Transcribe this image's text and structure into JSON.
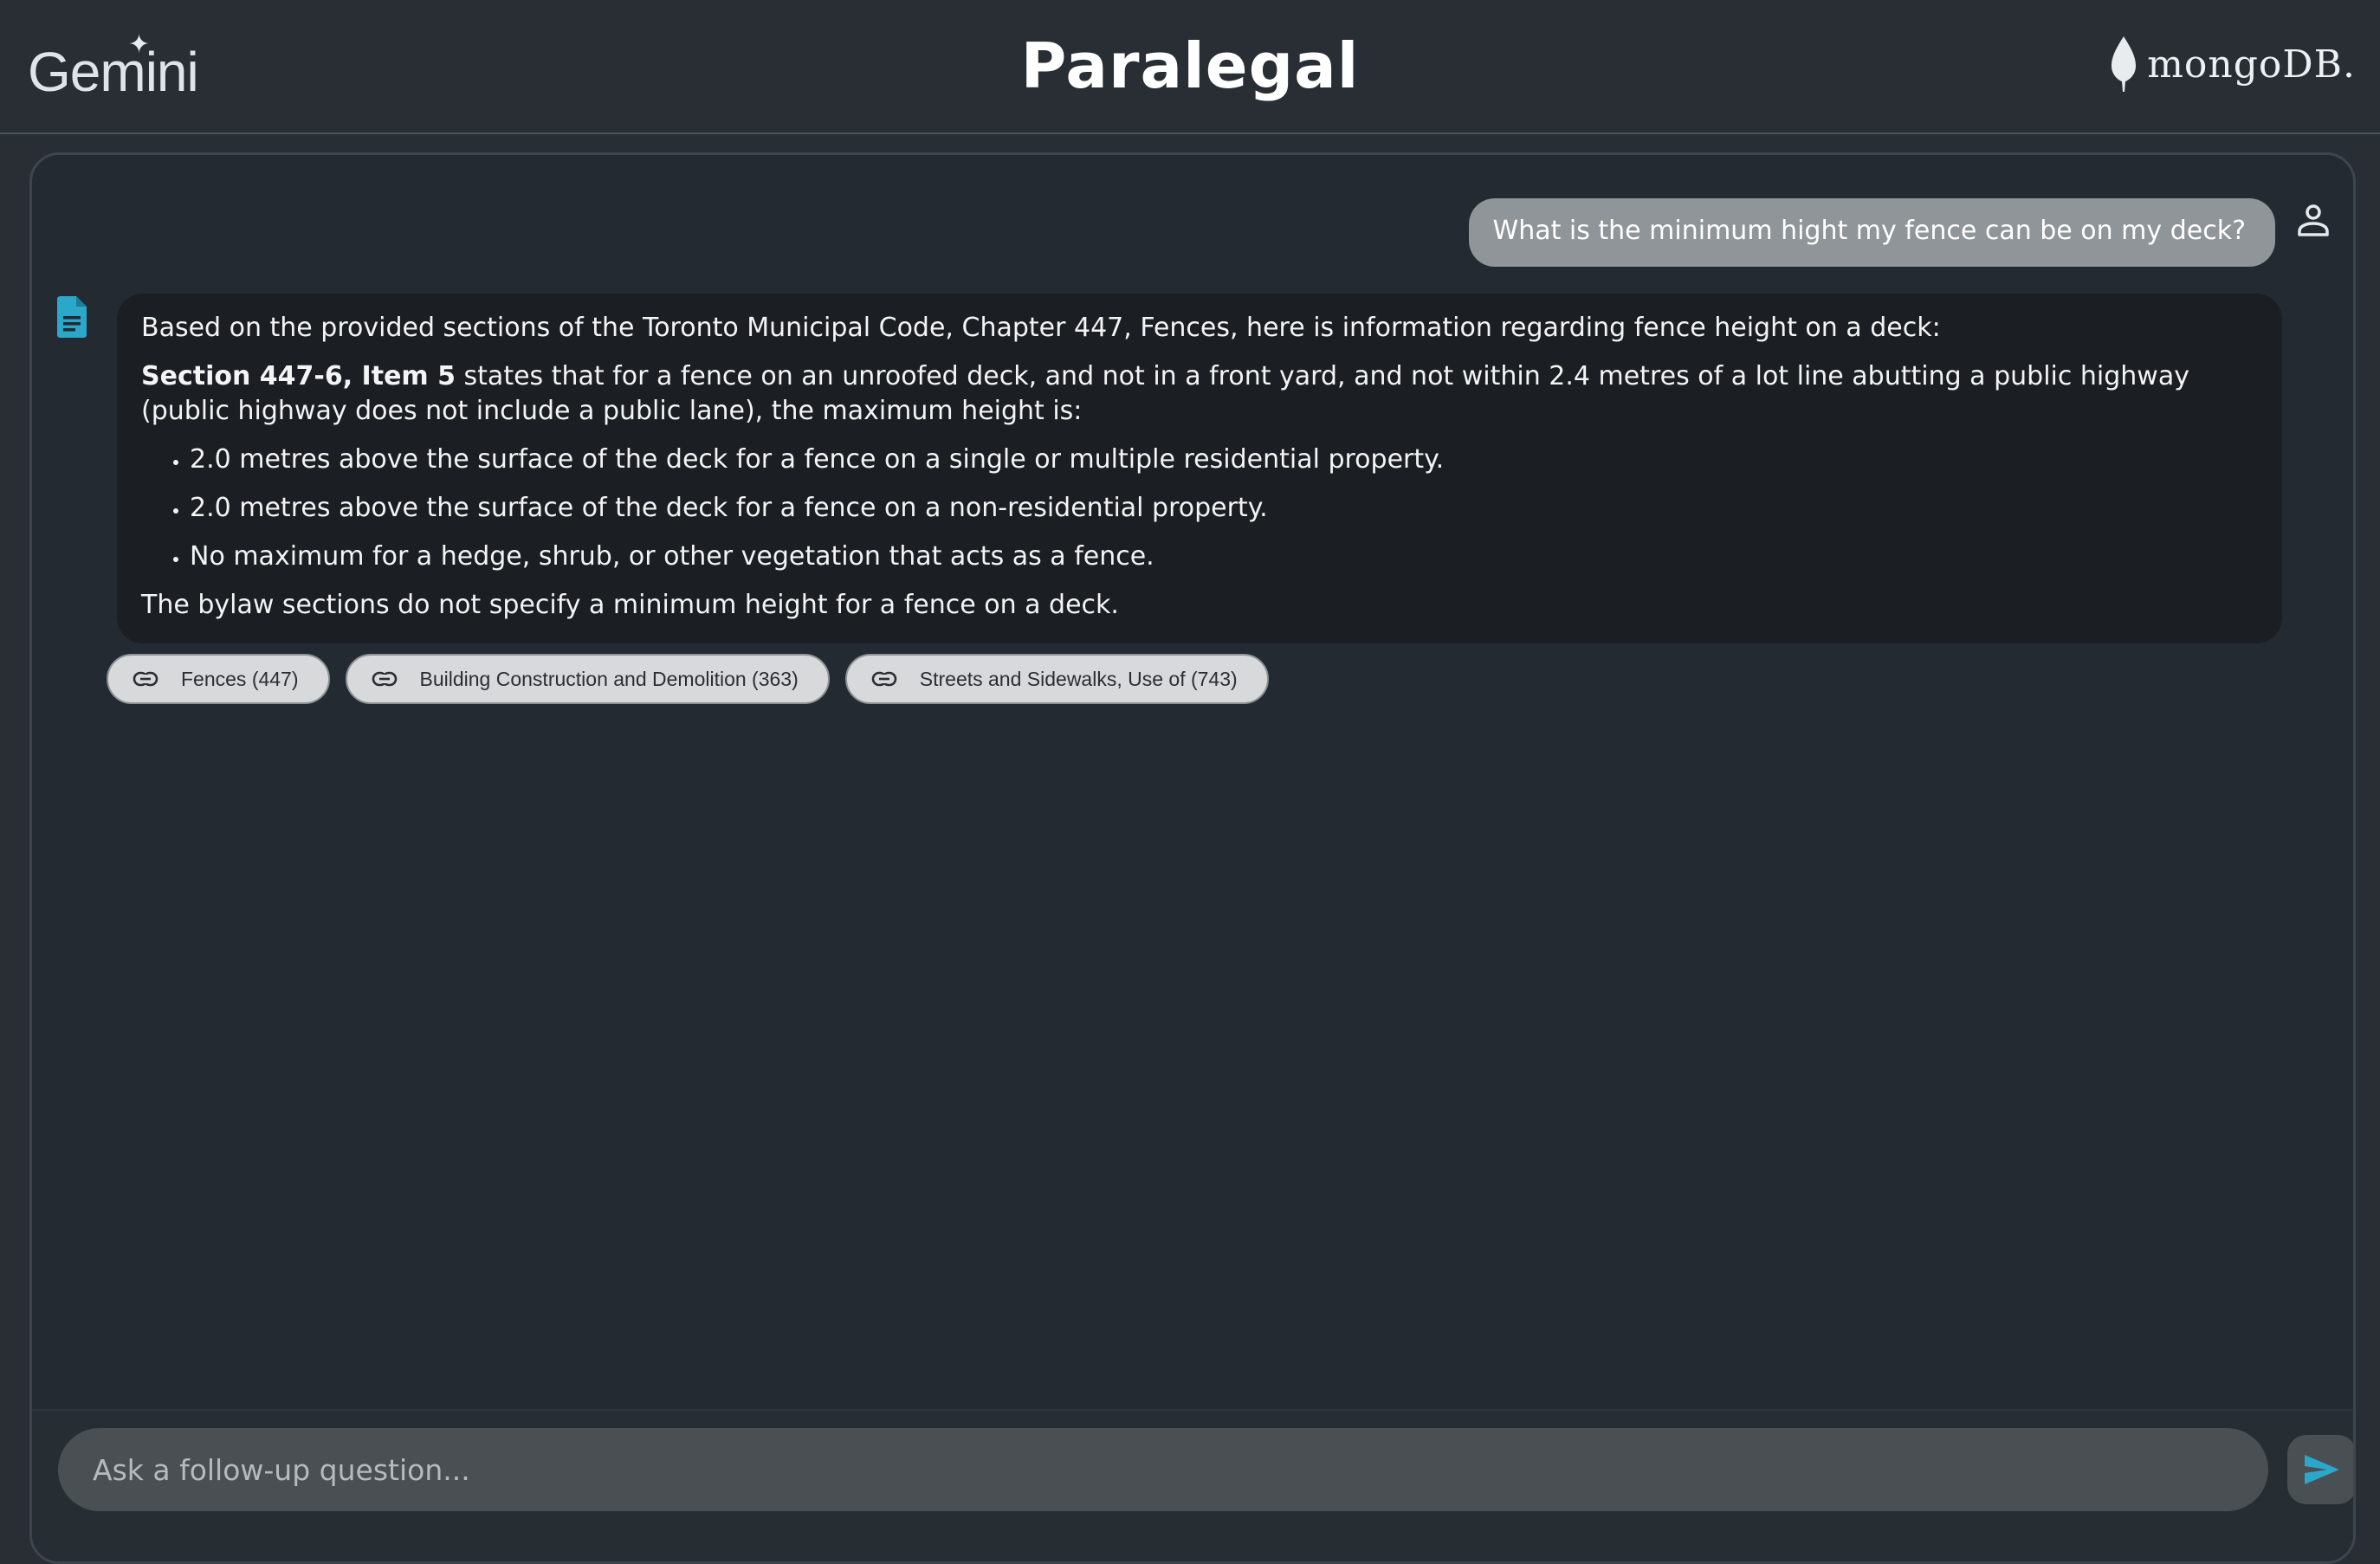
{
  "header": {
    "brand_left": "Gemini",
    "title": "Paralegal",
    "brand_right": "mongoDB."
  },
  "conversation": {
    "user_message": "What is the minimum hight my fence can be on my deck?",
    "bot_response": {
      "intro": "Based on the provided sections of the Toronto Municipal Code, Chapter 447, Fences, here is information regarding fence height on a deck:",
      "section_ref": "Section 447-6, Item 5",
      "section_text": " states that for a fence on an unroofed deck, and not in a front yard, and not within 2.4 metres of a lot line abutting a public highway (public highway does not include a public lane), the maximum height is:",
      "bullets": [
        "2.0 metres above the surface of the deck for a fence on a single or multiple residential property.",
        "2.0 metres above the surface of the deck for a fence on a non-residential property.",
        "No maximum for a hedge, shrub, or other vegetation that acts as a fence."
      ],
      "conclusion": "The bylaw sections do not specify a minimum height for a fence on a deck."
    },
    "sources": [
      {
        "label": "Fences (447)",
        "icon": "link-icon"
      },
      {
        "label": "Building Construction and Demolition (363)",
        "icon": "link-icon"
      },
      {
        "label": "Streets and Sidewalks, Use of (743)",
        "icon": "link-icon"
      }
    ]
  },
  "input": {
    "placeholder": "Ask a follow-up question...",
    "value": ""
  },
  "icons": {
    "user": "person-outline-icon",
    "bot": "document-icon",
    "send": "send-icon"
  },
  "colors": {
    "background": "#282e34",
    "panel": "#232a31",
    "bot_bubble": "#1b1f23",
    "user_bubble": "#8f9599",
    "chip": "#d8d9da",
    "accent": "#2aa7c9",
    "mongodb_leaf": "#e8ecef"
  }
}
